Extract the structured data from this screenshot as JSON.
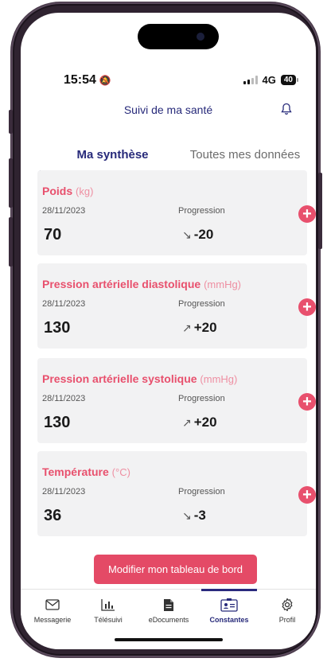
{
  "status_bar": {
    "time": "15:54",
    "network": "4G",
    "battery": "40"
  },
  "header": {
    "title": "Suivi de ma santé"
  },
  "tabs": [
    {
      "label": "Ma synthèse",
      "active": true
    },
    {
      "label": "Toutes mes données",
      "active": false
    }
  ],
  "progression_label": "Progression",
  "cards": [
    {
      "title": "Poids",
      "unit": "(kg)",
      "date": "28/11/2023",
      "value": "70",
      "trend": "-20",
      "trend_dir": "down"
    },
    {
      "title": "Pression artérielle diastolique",
      "unit": "(mmHg)",
      "date": "28/11/2023",
      "value": "130",
      "trend": "+20",
      "trend_dir": "up"
    },
    {
      "title": "Pression artérielle systolique",
      "unit": "(mmHg)",
      "date": "28/11/2023",
      "value": "130",
      "trend": "+20",
      "trend_dir": "up"
    },
    {
      "title": "Température",
      "unit": "(°C)",
      "date": "28/11/2023",
      "value": "36",
      "trend": "-3",
      "trend_dir": "down"
    }
  ],
  "cta": {
    "label": "Modifier mon tableau de bord"
  },
  "bottom_nav": [
    {
      "label": "Messagerie",
      "icon": "mail-icon",
      "active": false
    },
    {
      "label": "Télésuivi",
      "icon": "bar-chart-icon",
      "active": false
    },
    {
      "label": "eDocuments",
      "icon": "document-icon",
      "active": false
    },
    {
      "label": "Constantes",
      "icon": "id-card-icon",
      "active": true
    },
    {
      "label": "Profil",
      "icon": "gear-icon",
      "active": false
    }
  ],
  "colors": {
    "accent": "#e8506d",
    "brand": "#272a7a",
    "card_bg": "#f2f2f3"
  }
}
